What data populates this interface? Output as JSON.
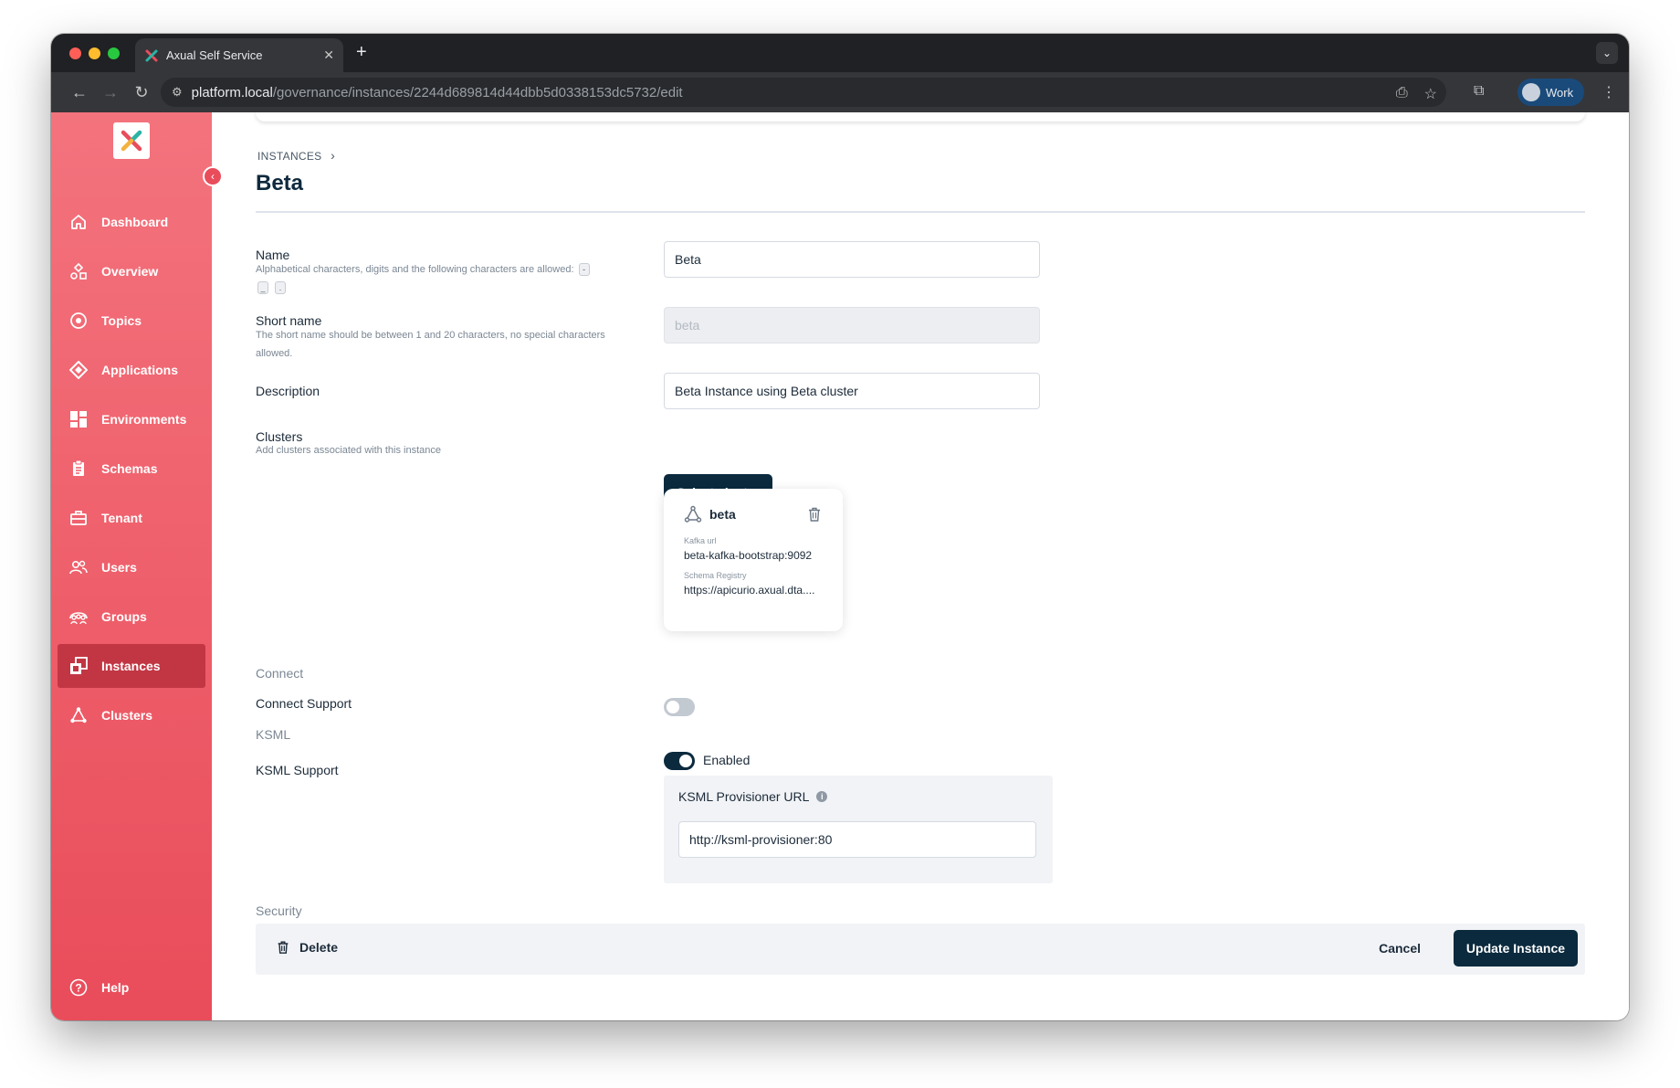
{
  "browser": {
    "tab_title": "Axual Self Service",
    "new_tab_label": "+",
    "url_host": "platform.local",
    "url_path": "/governance/instances/2244d689814d44dbb5d0338153dc5732/edit",
    "profile_label": "Work"
  },
  "sidebar": {
    "items": [
      {
        "label": "Dashboard",
        "icon": "home-icon"
      },
      {
        "label": "Overview",
        "icon": "overview-icon"
      },
      {
        "label": "Topics",
        "icon": "topics-icon"
      },
      {
        "label": "Applications",
        "icon": "applications-icon"
      },
      {
        "label": "Environments",
        "icon": "environments-icon"
      },
      {
        "label": "Schemas",
        "icon": "schemas-icon"
      },
      {
        "label": "Tenant",
        "icon": "tenant-icon"
      },
      {
        "label": "Users",
        "icon": "users-icon"
      },
      {
        "label": "Groups",
        "icon": "groups-icon"
      },
      {
        "label": "Instances",
        "icon": "instances-icon",
        "active": true
      },
      {
        "label": "Clusters",
        "icon": "clusters-icon"
      }
    ],
    "help_label": "Help"
  },
  "breadcrumb": {
    "label": "INSTANCES",
    "separator": "›"
  },
  "page": {
    "title": "Beta"
  },
  "form": {
    "name": {
      "label": "Name",
      "hint": "Alphabetical characters, digits and the following characters are allowed:",
      "allowed_chars": [
        "-",
        "_",
        "."
      ],
      "value": "Beta"
    },
    "short_name": {
      "label": "Short name",
      "hint": "The short name should be between 1 and 20 characters, no special characters allowed.",
      "value": "beta"
    },
    "description": {
      "label": "Description",
      "value": "Beta Instance using Beta cluster"
    },
    "clusters": {
      "label": "Clusters",
      "hint": "Add clusters associated with this instance",
      "select_button": "Select cluster",
      "items": [
        {
          "name": "beta",
          "kafka_url_label": "Kafka url",
          "kafka_url": "beta-kafka-bootstrap:9092",
          "schema_registry_label": "Schema Registry",
          "schema_registry": "https://apicurio.axual.dta...."
        }
      ]
    },
    "connect": {
      "section": "Connect",
      "label": "Connect Support",
      "enabled": false
    },
    "ksml": {
      "section": "KSML",
      "label": "KSML Support",
      "enabled": true,
      "enabled_label": "Enabled",
      "provisioner_label": "KSML Provisioner URL",
      "provisioner_url": "http://ksml-provisioner:80"
    },
    "security": {
      "section": "Security"
    }
  },
  "footer": {
    "delete_label": "Delete",
    "cancel_label": "Cancel",
    "update_label": "Update Instance"
  },
  "colors": {
    "sidebar_top": "#f3737d",
    "sidebar_active": "#c23644",
    "primary": "#0b2a3e"
  }
}
